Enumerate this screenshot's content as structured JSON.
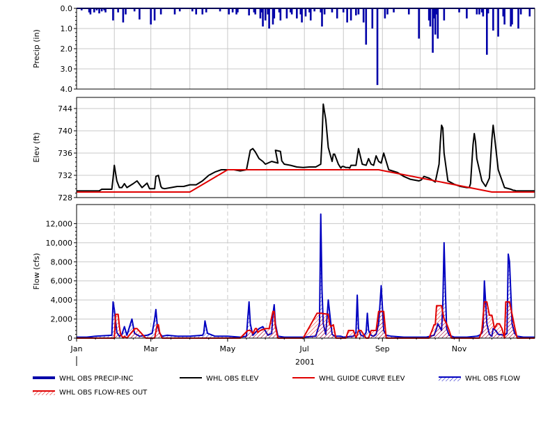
{
  "chart_data": [
    {
      "type": "bar",
      "panel": "precipitation",
      "ylabel": "Precip (in)",
      "ylim": [
        0,
        4
      ],
      "y_inverted": true,
      "yticks": [
        0,
        1,
        2,
        3,
        4
      ],
      "ytick_labels": [
        "0.0",
        "1.0",
        "2.0",
        "3.0",
        "4.0"
      ],
      "grid": true,
      "series": [
        {
          "name": "WHL OBS PRECIP-INC",
          "color": "#0000a8",
          "x": [
            4,
            10,
            11,
            14,
            16,
            18,
            20,
            22,
            23,
            29,
            33,
            37,
            39,
            46,
            50,
            59,
            62,
            67,
            78,
            82,
            92,
            95,
            100,
            103,
            114,
            121,
            124,
            127,
            128,
            137,
            141,
            142,
            146,
            147,
            148,
            150,
            152,
            153,
            156,
            157,
            161,
            162,
            167,
            170,
            171,
            175,
            178,
            179,
            182,
            185,
            186,
            189,
            194,
            195,
            197,
            203,
            207,
            212,
            215,
            218,
            222,
            224,
            228,
            230,
            235,
            239,
            245,
            247,
            252,
            264,
            272,
            280,
            281,
            283,
            284,
            285,
            286,
            287,
            292,
            304,
            310,
            318,
            320,
            322,
            323,
            326,
            327,
            331,
            335,
            339,
            340,
            345,
            346,
            351,
            353,
            360
          ],
          "values": [
            0.1,
            0.2,
            0.3,
            0.2,
            0.1,
            0.25,
            0.15,
            0.1,
            0.2,
            0.6,
            0.2,
            0.7,
            0.3,
            0.15,
            0.55,
            0.8,
            0.6,
            0.3,
            0.3,
            0.15,
            0.15,
            0.3,
            0.3,
            0.2,
            0.15,
            0.3,
            0.2,
            0.3,
            0.2,
            0.35,
            0.2,
            0.3,
            0.5,
            0.2,
            0.9,
            0.6,
            0.3,
            1.0,
            0.8,
            0.5,
            0.2,
            0.6,
            0.5,
            0.2,
            0.3,
            0.5,
            0.3,
            0.7,
            0.4,
            0.2,
            0.6,
            0.15,
            0.2,
            0.9,
            0.3,
            0.2,
            0.5,
            0.2,
            0.7,
            0.6,
            0.35,
            0.3,
            0.7,
            1.8,
            1.0,
            3.8,
            0.5,
            0.3,
            0.2,
            0.3,
            1.5,
            0.6,
            0.9,
            2.2,
            0.5,
            1.3,
            0.3,
            1.5,
            0.6,
            0.2,
            0.5,
            0.3,
            0.3,
            0.2,
            0.4,
            2.3,
            0.25,
            1.1,
            1.4,
            0.4,
            0.8,
            0.9,
            0.8,
            1.0,
            0.3,
            0.4
          ]
        }
      ]
    },
    {
      "type": "line",
      "panel": "elevation",
      "ylabel": "Elev (ft)",
      "ylim": [
        728,
        746
      ],
      "yticks": [
        728,
        732,
        736,
        740,
        744
      ],
      "ytick_labels": [
        "728",
        "732",
        "736",
        "740",
        "744"
      ],
      "grid": true,
      "series": [
        {
          "name": "WHL OBS ELEV",
          "color": "#000000",
          "x": [
            0,
            10,
            18,
            20,
            28,
            29,
            30,
            32,
            34,
            36,
            38,
            40,
            45,
            48,
            52,
            56,
            58,
            62,
            63,
            65,
            67,
            68,
            70,
            75,
            80,
            85,
            90,
            95,
            100,
            105,
            110,
            115,
            120,
            125,
            130,
            135,
            138,
            140,
            142,
            145,
            148,
            150,
            155,
            160,
            158,
            162,
            163,
            165,
            170,
            175,
            180,
            185,
            190,
            194,
            195,
            196,
            198,
            200,
            203,
            204,
            205,
            208,
            210,
            211,
            212,
            214,
            216,
            217,
            218,
            222,
            224,
            227,
            230,
            232,
            234,
            236,
            238,
            240,
            242,
            244,
            248,
            255,
            260,
            265,
            272,
            274,
            276,
            280,
            285,
            288,
            289,
            290,
            291,
            292,
            295,
            300,
            305,
            310,
            312,
            313,
            314,
            315,
            316,
            317,
            318,
            322,
            325,
            328,
            329,
            330,
            331,
            332,
            335,
            340,
            345,
            346,
            347,
            348,
            349,
            350,
            355,
            360,
            364
          ],
          "values": [
            729.2,
            729.2,
            729.2,
            729.5,
            729.5,
            731.5,
            733.8,
            731.0,
            729.8,
            729.8,
            730.5,
            729.8,
            730.5,
            731.0,
            729.8,
            730.6,
            729.6,
            729.6,
            731.8,
            732.0,
            730.0,
            729.7,
            729.6,
            729.8,
            730.0,
            730.0,
            730.3,
            730.3,
            731.0,
            732.0,
            732.6,
            733.0,
            733.0,
            733.0,
            732.8,
            733.0,
            736.5,
            736.8,
            736.2,
            735.0,
            734.5,
            734.0,
            734.5,
            734.2,
            736.5,
            736.3,
            734.6,
            734.0,
            733.8,
            733.5,
            733.4,
            733.5,
            733.5,
            734.0,
            738.5,
            744.8,
            742.0,
            737.0,
            734.5,
            735.8,
            735.8,
            734.0,
            733.3,
            733.6,
            733.6,
            733.4,
            733.4,
            733.3,
            733.8,
            733.8,
            736.8,
            734.0,
            733.8,
            735.0,
            734.0,
            733.8,
            735.5,
            734.5,
            734.2,
            736.0,
            733.0,
            732.5,
            731.8,
            731.3,
            731.0,
            731.2,
            731.8,
            731.5,
            730.8,
            734.0,
            738.0,
            741.0,
            740.5,
            736.0,
            731.0,
            730.4,
            730.0,
            729.8,
            729.8,
            730.5,
            734.0,
            737.5,
            739.5,
            738.0,
            735.0,
            731.0,
            730.0,
            731.5,
            735.0,
            738.5,
            741.0,
            739.0,
            733.0,
            729.8,
            729.5,
            729.4,
            729.3,
            729.3,
            729.2,
            729.2,
            729.2,
            729.2,
            729.2
          ],
          "x_note": "",
          "values_note": ""
        },
        {
          "name": "WHL GUIDE CURVE ELEV",
          "color": "#e00000",
          "x": [
            0,
            90,
            120,
            240,
            330,
            364
          ],
          "values": [
            729.0,
            729.0,
            733.0,
            733.0,
            729.0,
            729.0
          ]
        }
      ]
    },
    {
      "type": "line",
      "panel": "flow",
      "ylabel": "Flow (cfs)",
      "ylim": [
        0,
        14000
      ],
      "yticks": [
        0,
        2000,
        4000,
        6000,
        8000,
        10000,
        12000
      ],
      "ytick_labels": [
        "0",
        "2,000",
        "4,000",
        "6,000",
        "8,000",
        "10,000",
        "12,000"
      ],
      "grid": true,
      "xlabel": "2001",
      "xticks": [
        0,
        59,
        120,
        181,
        243,
        304
      ],
      "xtick_labels": [
        "Jan",
        "Mar",
        "May",
        "Jul",
        "Sep",
        "Nov"
      ],
      "series": [
        {
          "name": "WHL OBS FLOW",
          "color": "#0000c0",
          "x": [
            0,
            8,
            15,
            28,
            29,
            30,
            32,
            34,
            36,
            38,
            40,
            44,
            46,
            50,
            56,
            60,
            62,
            63,
            64,
            66,
            68,
            72,
            80,
            90,
            100,
            101,
            102,
            104,
            110,
            120,
            130,
            135,
            136,
            137,
            138,
            140,
            145,
            148,
            152,
            155,
            156,
            157,
            158,
            160,
            165,
            170,
            180,
            190,
            193,
            194,
            195,
            196,
            198,
            200,
            202,
            203,
            204,
            205,
            206,
            208,
            210,
            212,
            220,
            222,
            223,
            224,
            226,
            228,
            230,
            231,
            232,
            234,
            236,
            238,
            240,
            241,
            242,
            244,
            246,
            250,
            260,
            270,
            278,
            284,
            286,
            287,
            290,
            291,
            292,
            293,
            294,
            296,
            300,
            310,
            318,
            320,
            322,
            323,
            324,
            326,
            328,
            330,
            331,
            333,
            335,
            340,
            342,
            343,
            344,
            346,
            348,
            350,
            355,
            364
          ],
          "values": [
            100,
            100,
            200,
            300,
            3800,
            3000,
            600,
            200,
            400,
            1200,
            300,
            2000,
            500,
            200,
            300,
            500,
            2000,
            3000,
            1500,
            500,
            200,
            300,
            200,
            200,
            300,
            500,
            1800,
            500,
            200,
            200,
            100,
            200,
            2000,
            3800,
            1500,
            300,
            1000,
            1200,
            300,
            500,
            2500,
            3500,
            1500,
            200,
            100,
            100,
            100,
            200,
            1500,
            13000,
            5000,
            1500,
            400,
            4000,
            1500,
            400,
            300,
            200,
            200,
            200,
            200,
            100,
            200,
            600,
            4500,
            1000,
            300,
            200,
            600,
            2600,
            800,
            300,
            200,
            400,
            1500,
            3500,
            5500,
            800,
            300,
            200,
            100,
            100,
            100,
            300,
            1000,
            1500,
            800,
            3500,
            10000,
            5000,
            1000,
            300,
            100,
            100,
            200,
            300,
            500,
            1200,
            6000,
            1500,
            400,
            200,
            1000,
            800,
            400,
            300,
            500,
            8800,
            8000,
            1500,
            500,
            200,
            100,
            100
          ]
        },
        {
          "name": "WHL OBS FLOW-RES OUT",
          "color": "#e00000",
          "x": [
            0,
            20,
            30,
            31,
            33,
            34,
            35,
            37,
            38,
            40,
            45,
            46,
            48,
            55,
            62,
            64,
            65,
            66,
            68,
            80,
            100,
            110,
            130,
            136,
            138,
            140,
            142,
            143,
            144,
            146,
            150,
            153,
            156,
            157,
            158,
            160,
            170,
            180,
            191,
            192,
            194,
            200,
            201,
            202,
            204,
            206,
            214,
            216,
            218,
            220,
            222,
            224,
            226,
            230,
            232,
            234,
            236,
            238,
            240,
            242,
            244,
            246,
            250,
            260,
            280,
            283,
            284,
            285,
            286,
            288,
            290,
            292,
            294,
            296,
            298,
            300,
            310,
            320,
            322,
            324,
            326,
            328,
            330,
            332,
            334,
            336,
            338,
            340,
            341,
            342,
            344,
            346,
            348,
            350,
            355,
            364
          ],
          "values": [
            0,
            0,
            0,
            2500,
            2500,
            1200,
            400,
            0,
            200,
            0,
            800,
            1000,
            1000,
            0,
            0,
            1400,
            1400,
            600,
            0,
            0,
            0,
            0,
            0,
            800,
            800,
            500,
            1000,
            1000,
            600,
            800,
            1000,
            1000,
            2800,
            2800,
            1200,
            0,
            0,
            0,
            2600,
            2600,
            2600,
            2500,
            1500,
            1200,
            1400,
            0,
            0,
            800,
            800,
            800,
            0,
            800,
            800,
            0,
            0,
            800,
            800,
            800,
            2800,
            2800,
            2800,
            0,
            0,
            0,
            0,
            1000,
            1400,
            1400,
            3400,
            3400,
            3400,
            2000,
            1500,
            800,
            0,
            0,
            0,
            0,
            800,
            3800,
            3800,
            2400,
            2400,
            1000,
            1500,
            1500,
            1000,
            0,
            3800,
            3800,
            3800,
            2500,
            1200,
            0,
            0,
            0
          ]
        }
      ]
    }
  ],
  "legend": {
    "items": [
      {
        "key": "precip",
        "label": "WHL OBS PRECIP-INC",
        "color": "#0000a8",
        "style": "thick-bar"
      },
      {
        "key": "elev",
        "label": "WHL OBS ELEV",
        "color": "#000000",
        "style": "line"
      },
      {
        "key": "guide",
        "label": "WHL GUIDE CURVE ELEV",
        "color": "#e00000",
        "style": "line"
      },
      {
        "key": "flow",
        "label": "WHL OBS FLOW",
        "color": "#0000c0",
        "style": "hatched"
      },
      {
        "key": "resout",
        "label": "WHL OBS FLOW-RES OUT",
        "color": "#e00000",
        "style": "hatched"
      }
    ]
  },
  "xaxis": {
    "year_label": "2001",
    "month_labels": [
      "Jan",
      "Mar",
      "May",
      "Jul",
      "Sep",
      "Nov"
    ]
  }
}
